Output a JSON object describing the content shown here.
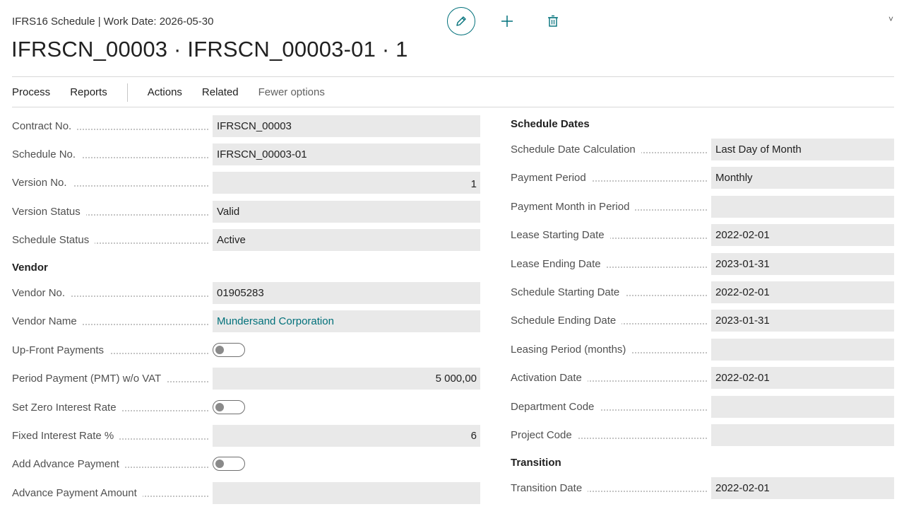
{
  "header": {
    "caption": "IFRS16 Schedule | Work Date: 2026-05-30",
    "title": "IFRSCN_00003 · IFRSCN_00003-01 · 1",
    "chevron": "˅"
  },
  "menu": {
    "process": "Process",
    "reports": "Reports",
    "actions": "Actions",
    "related": "Related",
    "fewer_options": "Fewer options"
  },
  "general": {
    "contract_no": {
      "label": "Contract No.",
      "value": "IFRSCN_00003"
    },
    "schedule_no": {
      "label": "Schedule No.",
      "value": "IFRSCN_00003-01"
    },
    "version_no": {
      "label": "Version No.",
      "value": "1"
    },
    "version_status": {
      "label": "Version Status",
      "value": "Valid"
    },
    "schedule_status": {
      "label": "Schedule Status",
      "value": "Active"
    }
  },
  "vendor": {
    "section": "Vendor",
    "vendor_no": {
      "label": "Vendor No.",
      "value": "01905283"
    },
    "vendor_name": {
      "label": "Vendor Name",
      "value": "Mundersand Corporation"
    },
    "upfront_payments": {
      "label": "Up-Front Payments",
      "value": false
    },
    "period_payment": {
      "label": "Period Payment (PMT) w/o VAT",
      "value": "5 000,00"
    },
    "zero_interest": {
      "label": "Set Zero Interest Rate",
      "value": false
    },
    "fixed_interest": {
      "label": "Fixed Interest Rate %",
      "value": "6"
    },
    "add_advance": {
      "label": "Add Advance Payment",
      "value": false
    },
    "advance_amount": {
      "label": "Advance Payment Amount",
      "value": ""
    }
  },
  "schedule_dates": {
    "section": "Schedule Dates",
    "date_calc": {
      "label": "Schedule Date Calculation",
      "value": "Last Day of Month"
    },
    "payment_period": {
      "label": "Payment Period",
      "value": "Monthly"
    },
    "payment_month": {
      "label": "Payment Month in Period",
      "value": ""
    },
    "lease_start": {
      "label": "Lease Starting Date",
      "value": "2022-02-01"
    },
    "lease_end": {
      "label": "Lease Ending Date",
      "value": "2023-01-31"
    },
    "schedule_start": {
      "label": "Schedule Starting Date",
      "value": "2022-02-01"
    },
    "schedule_end": {
      "label": "Schedule Ending Date",
      "value": "2023-01-31"
    },
    "leasing_period": {
      "label": "Leasing Period (months)",
      "value": ""
    },
    "activation_date": {
      "label": "Activation Date",
      "value": "2022-02-01"
    },
    "department_code": {
      "label": "Department Code",
      "value": ""
    },
    "project_code": {
      "label": "Project Code",
      "value": ""
    }
  },
  "transition": {
    "section": "Transition",
    "transition_date": {
      "label": "Transition Date",
      "value": "2022-02-01"
    }
  },
  "colors": {
    "accent": "#00707a",
    "field_bg": "#e9e9e9",
    "label": "#505050"
  },
  "icons": {
    "edit": "pencil-icon",
    "new": "plus-icon",
    "delete": "trash-icon"
  }
}
